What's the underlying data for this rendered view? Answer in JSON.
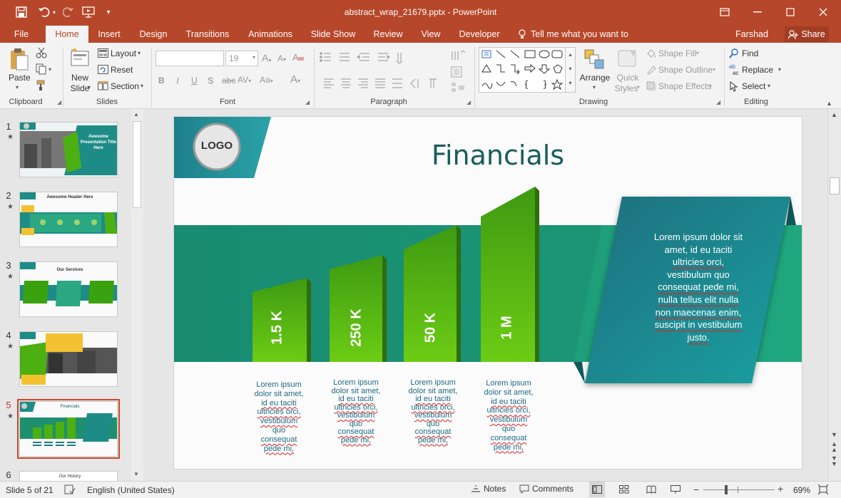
{
  "app": {
    "title": "abstract_wrap_21679.pptx - PowerPoint"
  },
  "tabs": [
    {
      "label": "File"
    },
    {
      "label": "Home"
    },
    {
      "label": "Insert"
    },
    {
      "label": "Design"
    },
    {
      "label": "Transitions"
    },
    {
      "label": "Animations"
    },
    {
      "label": "Slide Show"
    },
    {
      "label": "Review"
    },
    {
      "label": "View"
    },
    {
      "label": "Developer"
    }
  ],
  "active_tab": "Home",
  "tell_me": "Tell me what you want to do...",
  "user": "Farshad Iqbal",
  "share": "Share",
  "ribbon": {
    "clipboard": {
      "paste": "Paste",
      "label": "Clipboard"
    },
    "slides": {
      "new_slide_1": "New",
      "new_slide_2": "Slide",
      "layout": "Layout",
      "reset": "Reset",
      "section": "Section",
      "label": "Slides"
    },
    "font": {
      "size": "19",
      "label": "Font"
    },
    "paragraph": {
      "label": "Paragraph"
    },
    "drawing": {
      "arrange": "Arrange",
      "quick_styles_1": "Quick",
      "quick_styles_2": "Styles",
      "shape_fill": "Shape Fill",
      "shape_outline": "Shape Outline",
      "shape_effects": "Shape Effects",
      "label": "Drawing"
    },
    "editing": {
      "find": "Find",
      "replace": "Replace",
      "select": "Select",
      "label": "Editing"
    }
  },
  "thumbnails": [
    {
      "num": "1",
      "text": "Awesome Presentation Title Here"
    },
    {
      "num": "2",
      "text": "Awesome Header Here"
    },
    {
      "num": "3",
      "text": "Our Services"
    },
    {
      "num": "4",
      "text": ""
    },
    {
      "num": "5",
      "text": "Financials"
    },
    {
      "num": "6",
      "text": "Our History"
    }
  ],
  "slide": {
    "logo": "LOGO",
    "title": "Financials",
    "bars": [
      {
        "label": "1.5 K",
        "caption": [
          "Lorem ipsum",
          "dolor sit amet,",
          "id eu taciti",
          "ultricies orci,",
          "vestibulum",
          "quo",
          "consequat",
          "pede mi,"
        ]
      },
      {
        "label": "250 K",
        "caption": [
          "Lorem ipsum",
          "dolor sit amet,",
          "id eu taciti",
          "ultricies orci,",
          "vestibulum",
          "quo",
          "consequat",
          "pede mi,"
        ]
      },
      {
        "label": "50 K",
        "caption": [
          "Lorem ipsum",
          "dolor sit amet,",
          "id eu taciti",
          "ultricies orci,",
          "vestibulum",
          "quo",
          "consequat",
          "pede mi,"
        ]
      },
      {
        "label": "1 M",
        "caption": [
          "Lorem ipsum",
          "dolor sit amet,",
          "id eu taciti",
          "ultricies orci,",
          "vestibulum",
          "quo",
          "consequat",
          "pede mi,"
        ]
      }
    ],
    "panel_lines": [
      "Lorem ipsum dolor sit",
      "amet, id eu taciti",
      "ultricies orci,",
      "vestibulum quo",
      "consequat pede mi,",
      "nulla tellus elit nulla",
      "non maecenas enim,",
      "suscipit in vestibulum",
      "justo."
    ]
  },
  "status": {
    "slide": "Slide 5 of 21",
    "language": "English (United States)",
    "notes": "Notes",
    "comments": "Comments",
    "zoom": "69%"
  },
  "colors": {
    "accent": "#b7472a",
    "teal": "#1e8c86",
    "green": "#4caf12",
    "title": "#1a5c5c"
  }
}
